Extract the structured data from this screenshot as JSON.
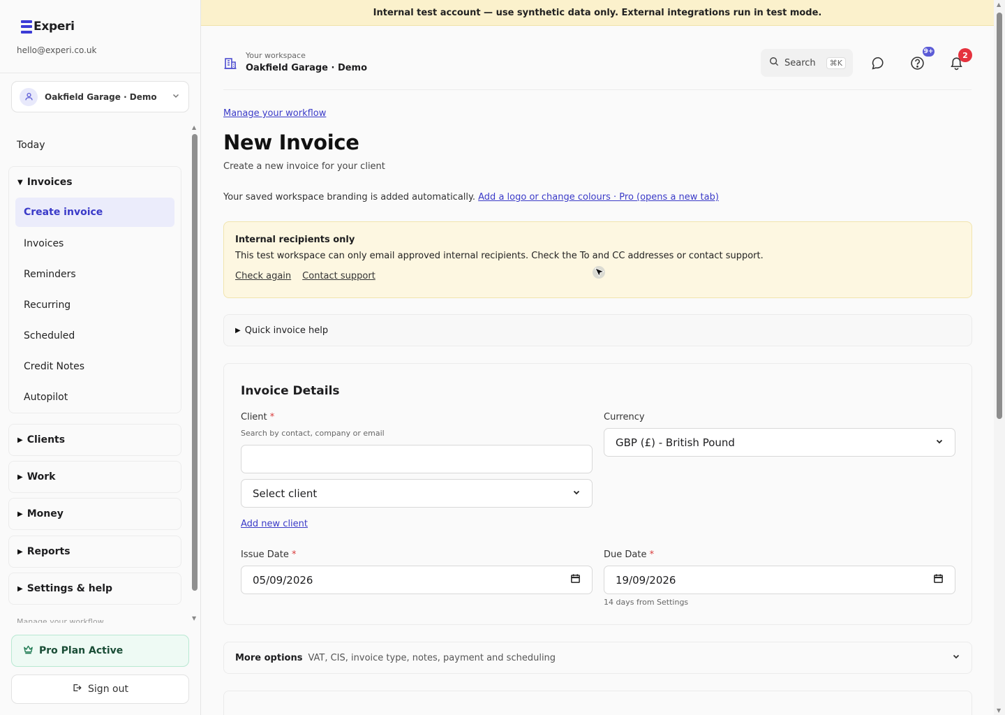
{
  "sidebar": {
    "brand": "Experi",
    "email": "hello@experi.co.uk",
    "workspace_switcher": "Oakfield Garage · Demo",
    "today_label": "Today",
    "invoices_group": {
      "label": "Invoices",
      "items": [
        "Create invoice",
        "Invoices",
        "Reminders",
        "Recurring",
        "Scheduled",
        "Credit Notes",
        "Autopilot"
      ]
    },
    "groups": [
      "Clients",
      "Work",
      "Money",
      "Reports",
      "Settings & help"
    ],
    "clipped_label": "Manage your workflow",
    "pro_plan": "Pro Plan Active",
    "sign_out": "Sign out"
  },
  "banner": "Internal test account — use synthetic data only. External integrations run in test mode.",
  "header": {
    "workspace_label": "Your workspace",
    "workspace_name": "Oakfield Garage · Demo",
    "search_label": "Search",
    "search_shortcut": "⌘K",
    "help_badge": "9+",
    "notifications_badge": "2"
  },
  "page": {
    "manage_link": "Manage your workflow",
    "title": "New Invoice",
    "subtitle": "Create a new invoice for your client",
    "branding_text": "Your saved workspace branding is added automatically.",
    "branding_link": "Add a logo or change colours · Pro (opens a new tab)"
  },
  "alert": {
    "title": "Internal recipients only",
    "body": "This test workspace can only email approved internal recipients. Check the To and CC addresses or contact support.",
    "check_again": "Check again",
    "contact_support": "Contact support"
  },
  "help_disclosure": "Quick invoice help",
  "invoice_details": {
    "title": "Invoice Details",
    "client_label": "Client",
    "client_hint": "Search by contact, company or email",
    "client_search_value": "",
    "client_select": "Select client",
    "add_client": "Add new client",
    "currency_label": "Currency",
    "currency_value": "GBP (£) - British Pound",
    "issue_date_label": "Issue Date",
    "issue_date_value": "05/09/2026",
    "due_date_label": "Due Date",
    "due_date_value": "19/09/2026",
    "due_hint": "14 days from Settings",
    "required_mark": "*"
  },
  "more_options": {
    "label": "More options",
    "detail": "VAT, CIS, invoice type, notes, payment and scheduling"
  },
  "colors": {
    "accent": "#3a3ac8",
    "banner_bg": "#fbf1cc",
    "alert_bg": "#fdf7e1",
    "pro_bg": "#eefaf4",
    "badge_red": "#e5323e",
    "badge_blue": "#5b5bd6"
  },
  "icons": [
    "building-icon",
    "search-icon",
    "chat-icon",
    "help-icon",
    "bell-icon",
    "user-icon",
    "crown-icon",
    "sign-out-icon",
    "calendar-icon",
    "chevron-down-icon"
  ]
}
